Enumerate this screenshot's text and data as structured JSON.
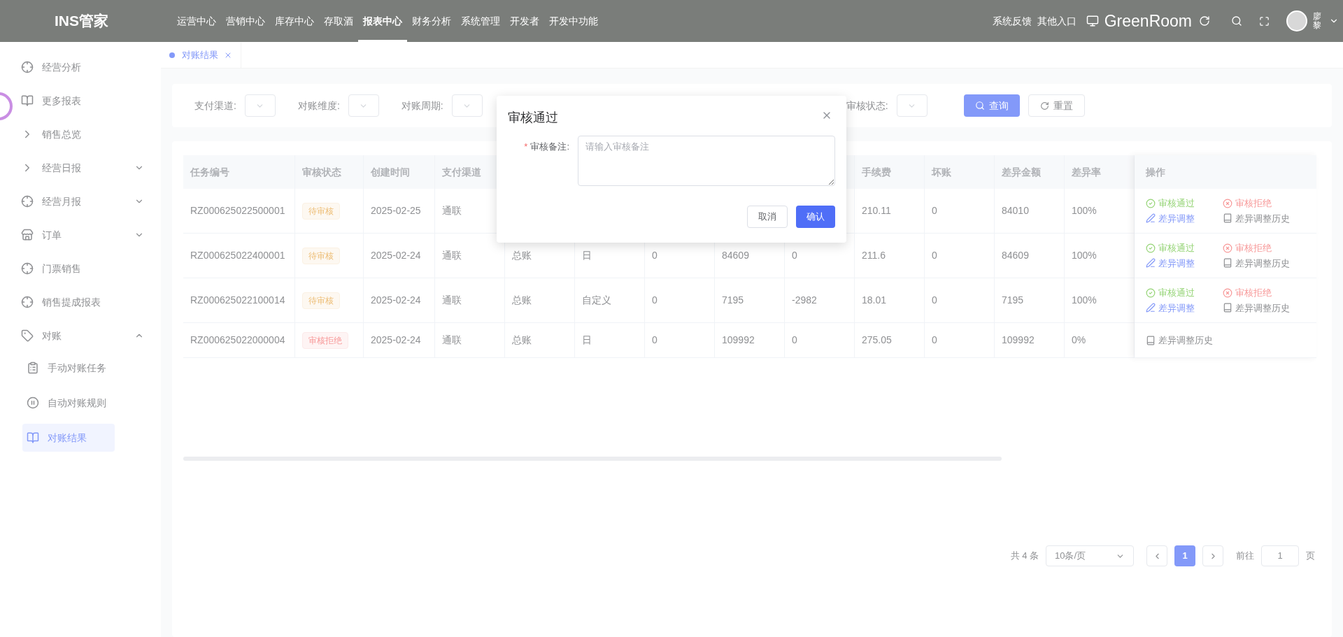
{
  "header": {
    "logo": "INS管家",
    "nav": [
      {
        "label": "运营中心",
        "selected": false
      },
      {
        "label": "营销中心",
        "selected": false
      },
      {
        "label": "库存中心",
        "selected": false
      },
      {
        "label": "存取酒",
        "selected": false
      },
      {
        "label": "报表中心",
        "selected": true
      },
      {
        "label": "财务分析",
        "selected": false
      },
      {
        "label": "系统管理",
        "selected": false
      },
      {
        "label": "开发者",
        "selected": false
      },
      {
        "label": "开发中功能",
        "selected": false
      }
    ],
    "links": [
      "系统反馈",
      "其他入口"
    ],
    "store": "GreenRoom",
    "user": "廖黎"
  },
  "sidebar": {
    "items": [
      {
        "label": "经营分析",
        "selected": false
      },
      {
        "label": "更多报表",
        "selected": false
      },
      {
        "label": "销售总览",
        "selected": false
      },
      {
        "label": "经营日报",
        "expanded": false,
        "selected": false
      },
      {
        "label": "经营月报",
        "expanded": false,
        "selected": false
      },
      {
        "label": "订单",
        "expanded": false,
        "selected": false
      },
      {
        "label": "门票销售",
        "selected": false
      },
      {
        "label": "销售提成报表",
        "selected": false
      },
      {
        "label": "对账",
        "expanded": true,
        "selected": false,
        "children": [
          {
            "label": "手动对账任务",
            "selected": false
          },
          {
            "label": "自动对账规则",
            "selected": false
          },
          {
            "label": "对账结果",
            "selected": true
          }
        ]
      }
    ]
  },
  "tabs": [
    {
      "label": "对账结果",
      "selected": true
    }
  ],
  "filters": {
    "fields": [
      {
        "label": "支付渠道:"
      },
      {
        "label": "对账维度:"
      },
      {
        "label": "对账周期:"
      },
      {
        "label": "审核状态:"
      }
    ],
    "search_button": "查询",
    "reset_button": "重置"
  },
  "table": {
    "columns": [
      "任务编号",
      "审核状态",
      "创建时间",
      "支付渠道",
      null,
      null,
      null,
      null,
      null,
      "手续费",
      "坏账",
      "差异金额",
      "差异率"
    ],
    "actions_column": "操作",
    "rows": [
      {
        "cells": [
          "RZ000625022500001",
          null,
          "2025-02-25",
          "通联",
          null,
          null,
          null,
          null,
          null,
          "210.11",
          "0",
          "84010",
          "100%"
        ],
        "status": {
          "label": "待审核",
          "kind": "pending"
        },
        "actions": [
          {
            "label": "审核通过",
            "kind": "approve"
          },
          {
            "label": "审核拒绝",
            "kind": "reject"
          },
          {
            "label": "差异调整",
            "kind": "adjust"
          },
          {
            "label": "差异调整历史",
            "kind": "history"
          }
        ]
      },
      {
        "cells": [
          "RZ000625022400001",
          null,
          "2025-02-24",
          "通联",
          "总账",
          "日",
          "0",
          "84609",
          "0",
          "211.6",
          "0",
          "84609",
          "100%"
        ],
        "status": {
          "label": "待审核",
          "kind": "pending"
        },
        "actions": [
          {
            "label": "审核通过",
            "kind": "approve"
          },
          {
            "label": "审核拒绝",
            "kind": "reject"
          },
          {
            "label": "差异调整",
            "kind": "adjust"
          },
          {
            "label": "差异调整历史",
            "kind": "history"
          }
        ]
      },
      {
        "cells": [
          "RZ000625022100014",
          null,
          "2025-02-24",
          "通联",
          "总账",
          "自定义",
          "0",
          "7195",
          "-2982",
          "18.01",
          "0",
          "7195",
          "100%"
        ],
        "status": {
          "label": "待审核",
          "kind": "pending"
        },
        "actions": [
          {
            "label": "审核通过",
            "kind": "approve"
          },
          {
            "label": "审核拒绝",
            "kind": "reject"
          },
          {
            "label": "差异调整",
            "kind": "adjust"
          },
          {
            "label": "差异调整历史",
            "kind": "history"
          }
        ]
      },
      {
        "cells": [
          "RZ000625022000004",
          null,
          "2025-02-24",
          "通联",
          "总账",
          "日",
          "0",
          "109992",
          "0",
          "275.05",
          "0",
          "109992",
          "0%"
        ],
        "status": {
          "label": "审核拒绝",
          "kind": "rejected"
        },
        "actions": [
          {
            "label": "差异调整历史",
            "kind": "history"
          }
        ]
      }
    ]
  },
  "pagination": {
    "total": "共 4 条",
    "page_size": "10条/页",
    "pages": [
      {
        "label": "1",
        "selected": true
      }
    ],
    "goto_label": "前往",
    "goto_value": "1",
    "goto_suffix": "页"
  },
  "dialog": {
    "title": "审核通过",
    "field_label": "审核备注:",
    "required_mark": "*",
    "placeholder": "请输入审核备注",
    "cancel": "取消",
    "confirm": "确认"
  }
}
